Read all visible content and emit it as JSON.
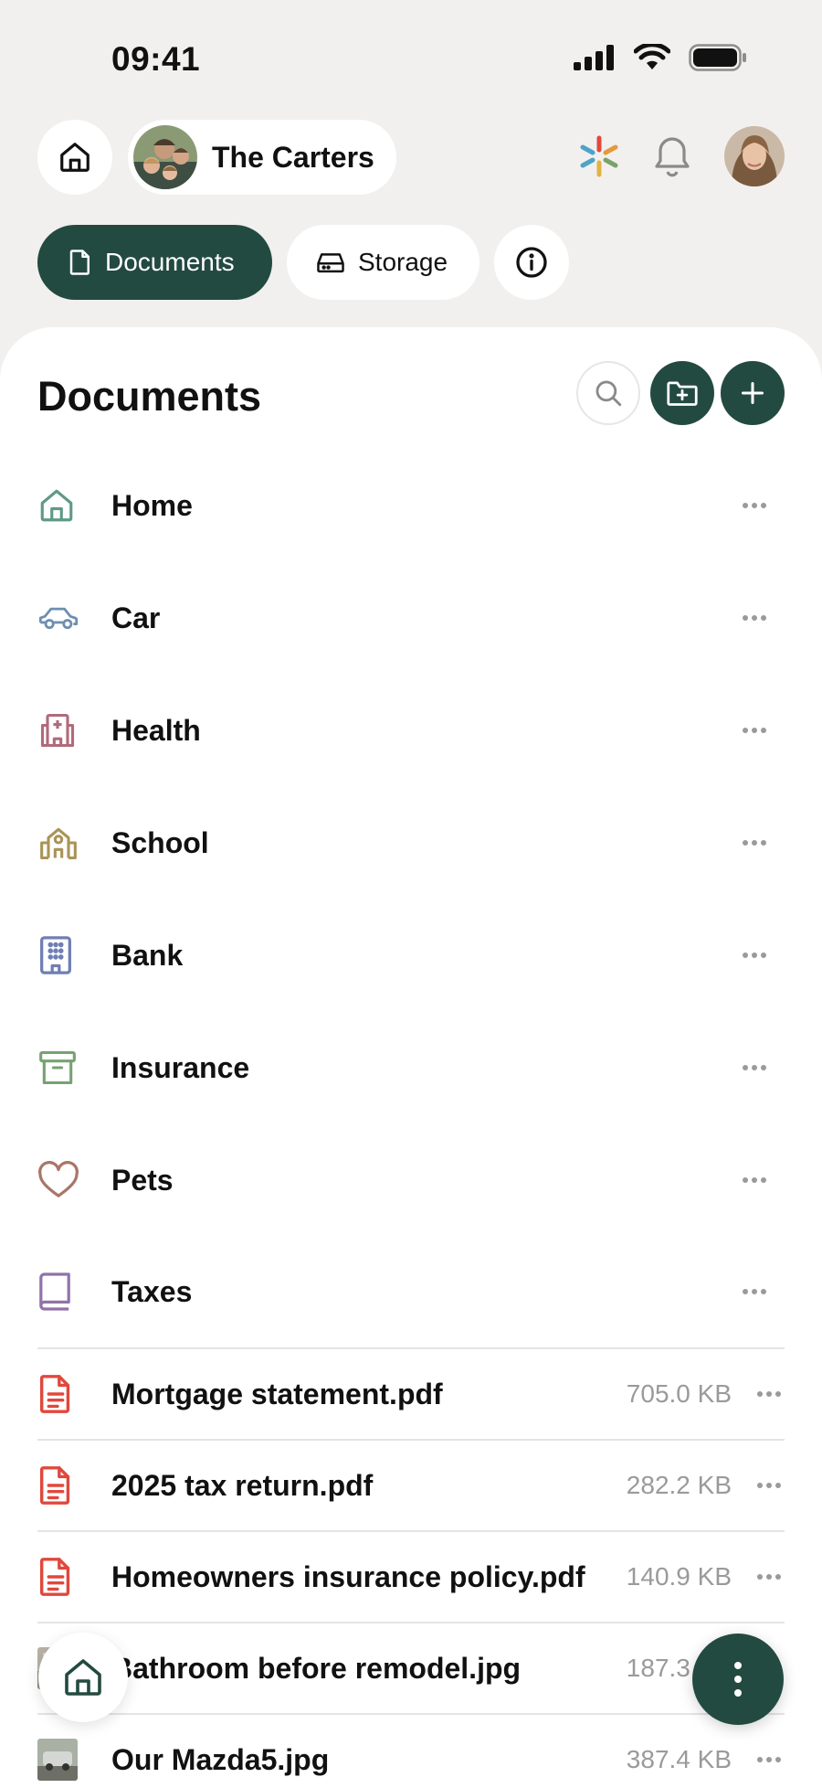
{
  "status_bar": {
    "time": "09:41"
  },
  "header": {
    "family_name": "The Carters"
  },
  "tabs": [
    {
      "label": "Documents",
      "active": true
    },
    {
      "label": "Storage",
      "active": false
    }
  ],
  "sheet": {
    "title": "Documents"
  },
  "folders": [
    {
      "label": "Home",
      "icon": "home-icon",
      "color": "#5f9a86"
    },
    {
      "label": "Car",
      "icon": "car-icon",
      "color": "#6d8fb0"
    },
    {
      "label": "Health",
      "icon": "hospital-icon",
      "color": "#b06a7a"
    },
    {
      "label": "School",
      "icon": "school-icon",
      "color": "#a99457"
    },
    {
      "label": "Bank",
      "icon": "building-icon",
      "color": "#6f7fb3"
    },
    {
      "label": "Insurance",
      "icon": "archive-box-icon",
      "color": "#76a272"
    },
    {
      "label": "Pets",
      "icon": "heart-icon",
      "color": "#a9766a"
    },
    {
      "label": "Taxes",
      "icon": "book-icon",
      "color": "#9272a8"
    }
  ],
  "files": [
    {
      "name": "Mortgage statement.pdf",
      "size": "705.0 KB",
      "icon": "pdf-file-icon"
    },
    {
      "name": "2025 tax return.pdf",
      "size": "282.2 KB",
      "icon": "pdf-file-icon"
    },
    {
      "name": "Homeowners insurance policy.pdf",
      "size": "140.9 KB",
      "icon": "pdf-file-icon"
    },
    {
      "name": "Bathroom before remodel.jpg",
      "size": "187.3 KB",
      "icon": "image-thumbnail"
    },
    {
      "name": "Our Mazda5.jpg",
      "size": "387.4 KB",
      "icon": "image-thumbnail"
    }
  ],
  "colors": {
    "accent": "#234a40",
    "pdf": "#e0483d",
    "muted": "#9a9a9a"
  }
}
